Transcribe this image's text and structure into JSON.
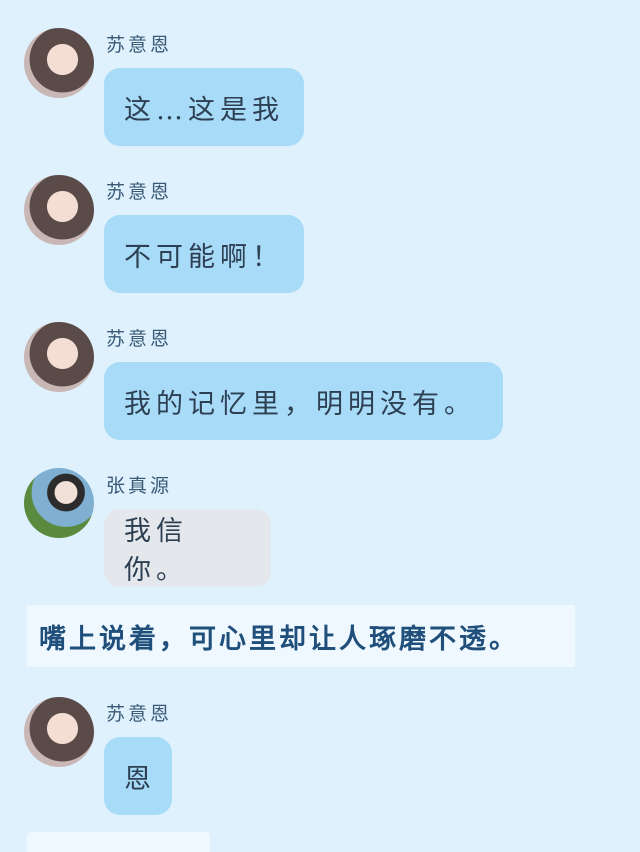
{
  "messages": [
    {
      "sender": "苏意恩",
      "text": "这…这是我",
      "style": "blue",
      "avatar": "girl"
    },
    {
      "sender": "苏意恩",
      "text": "不可能啊！",
      "style": "blue",
      "avatar": "girl"
    },
    {
      "sender": "苏意恩",
      "text": "我的记忆里，明明没有。",
      "style": "blue",
      "avatar": "girl"
    },
    {
      "sender": "张真源",
      "text": "我信你。",
      "style": "gray",
      "avatar": "boy"
    },
    {
      "sender": "苏意恩",
      "text": "恩",
      "style": "blue",
      "avatar": "girl"
    }
  ],
  "narration": "嘴上说着，可心里却让人琢磨不透。",
  "colors": {
    "background": "#dff1fd",
    "bubble_blue": "#a7dbf7",
    "bubble_gray": "#e4e7eb",
    "narration_text": "#1f4f7a"
  }
}
